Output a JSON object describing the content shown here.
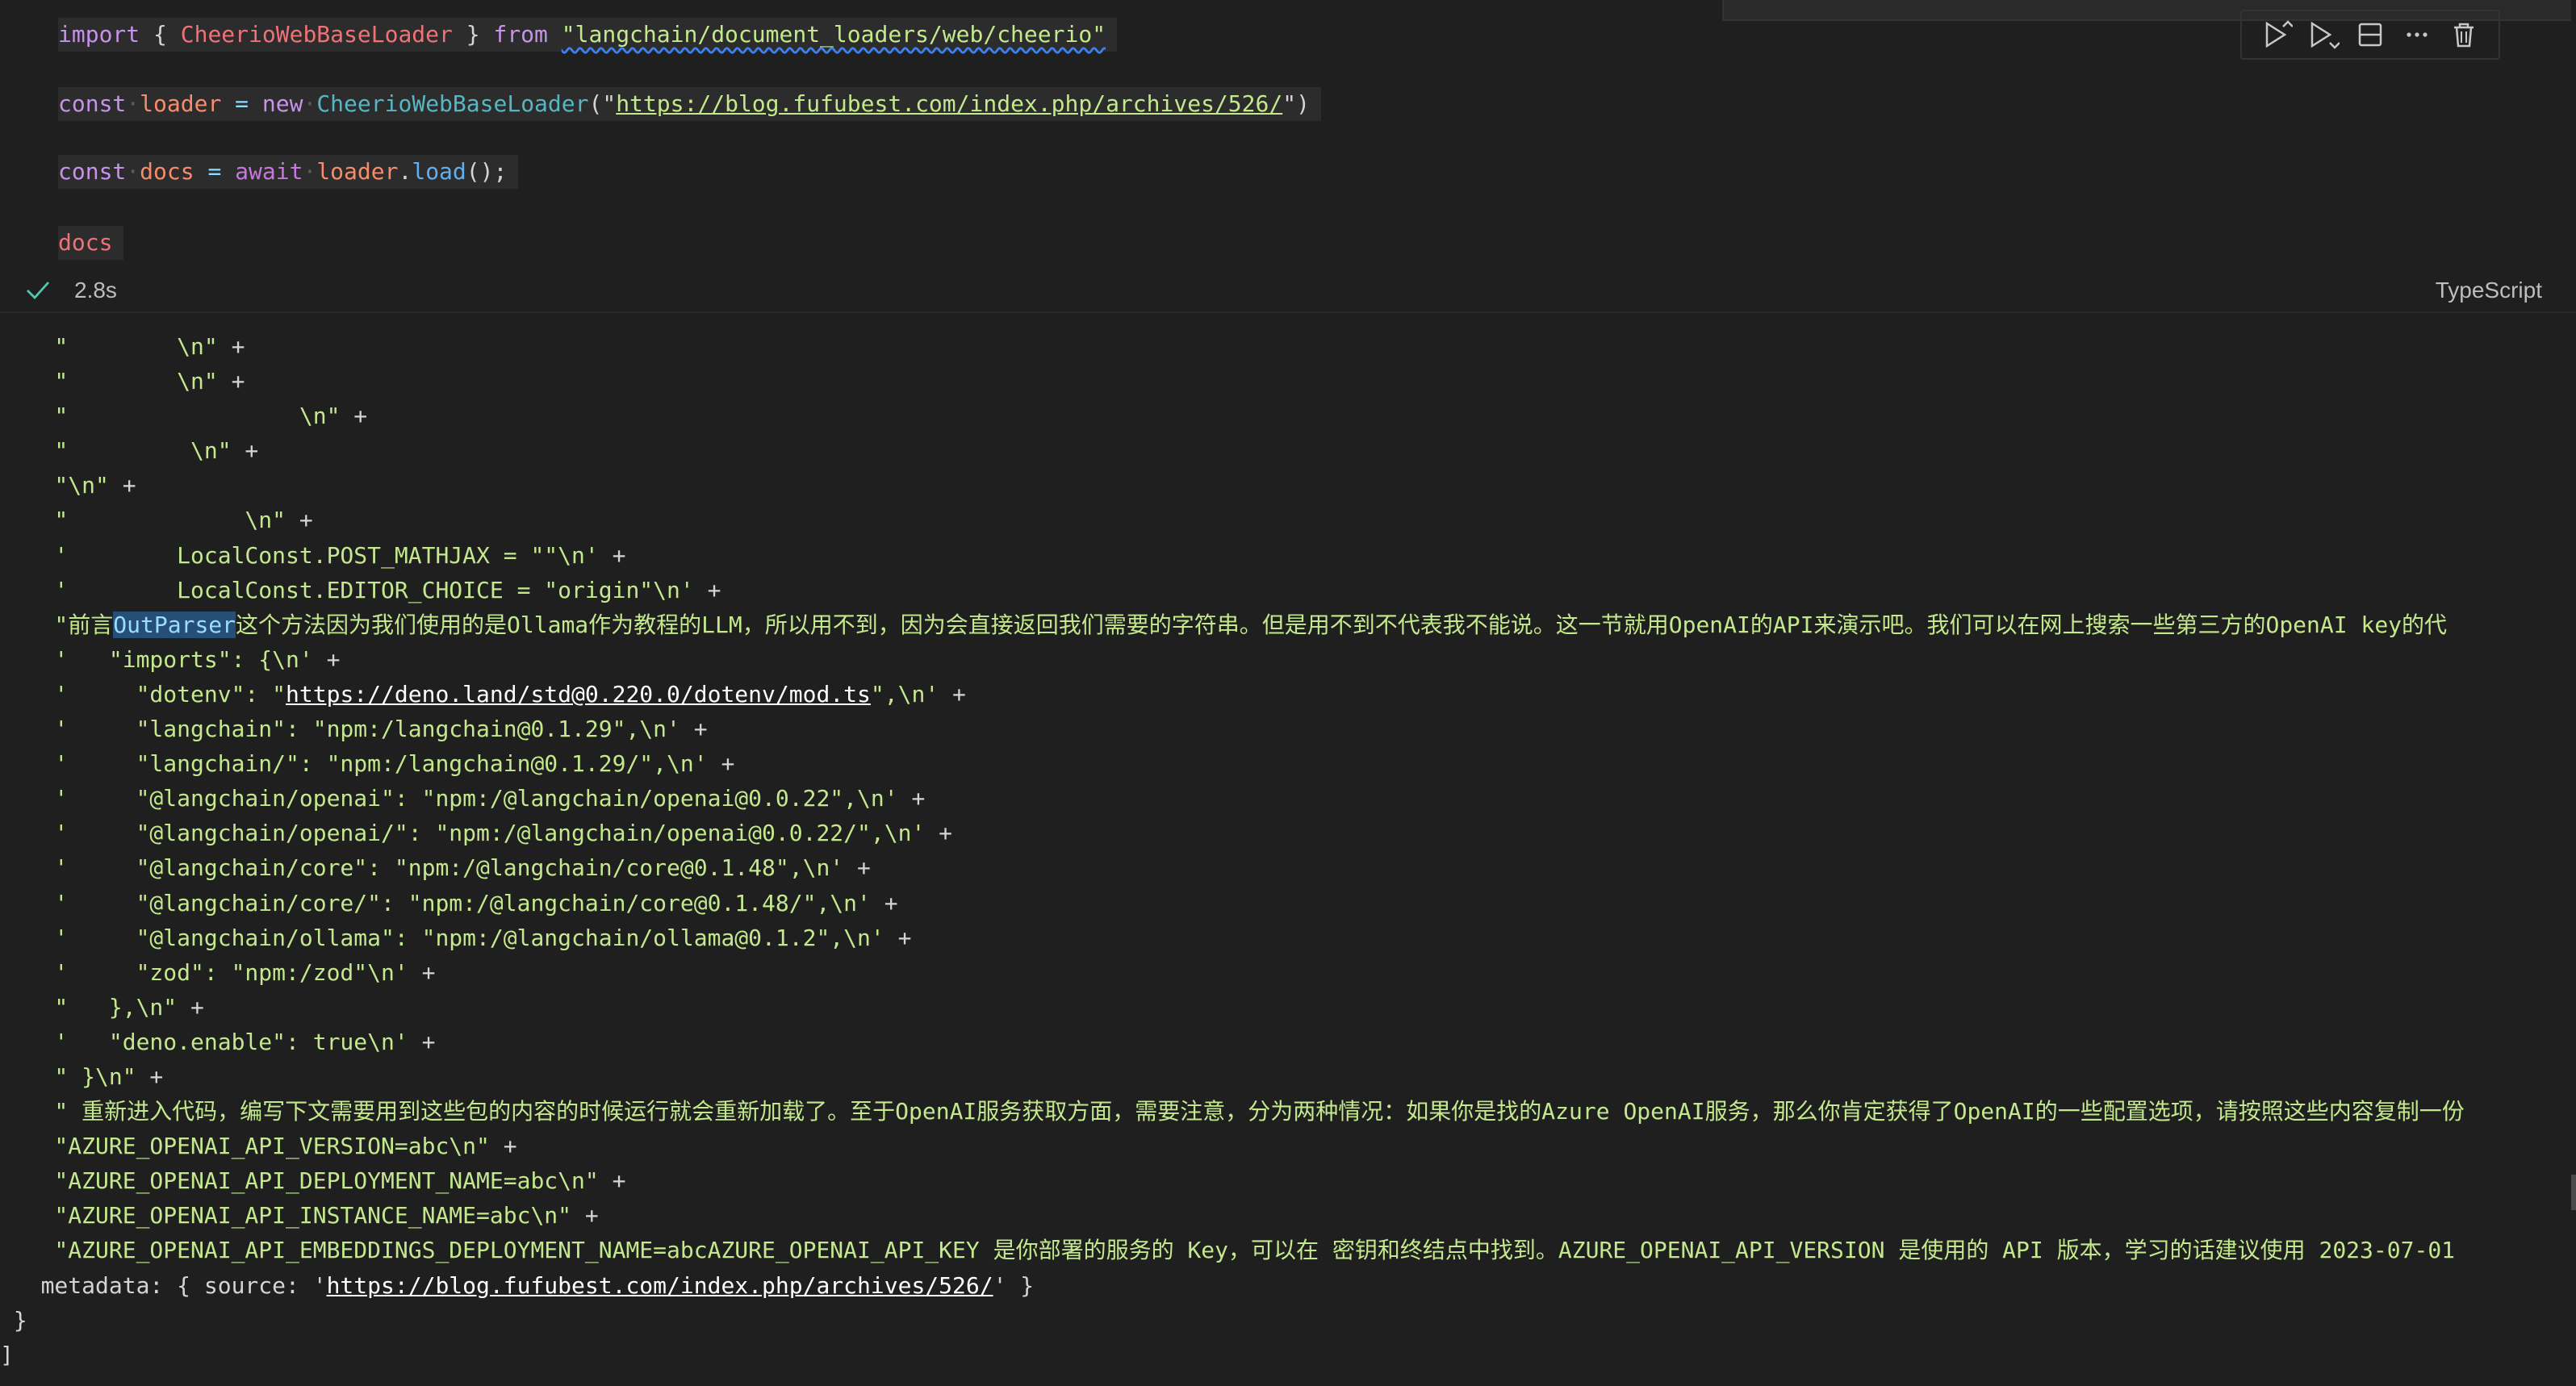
{
  "cell": {
    "code": {
      "line1": {
        "import_kw": "import",
        "brace_open": " { ",
        "class_name": "CheerioWebBaseLoader",
        "brace_close": " } ",
        "from_kw": "from",
        "space": " ",
        "module": "\"langchain/document_loaders/web/cheerio\""
      },
      "line2": {
        "const_kw": "const",
        "var_name": "loader",
        "eq": " = ",
        "new_kw": "new",
        "class_name": "CheerioWebBaseLoader",
        "paren_open": "(\"",
        "url": "https://blog.fufubest.com/index.php/archives/526/",
        "paren_close": "\")"
      },
      "line3": {
        "const_kw": "const",
        "var_name": "docs",
        "eq": " = ",
        "await_kw": "await",
        "obj": "loader",
        "dot": ".",
        "method": "load",
        "tail": "();"
      },
      "line4": {
        "var_name": "docs"
      }
    },
    "toolbar": {
      "icons": [
        "run-above-icon",
        "run-below-icon",
        "split-cell-icon",
        "more-icon",
        "delete-icon"
      ]
    },
    "status": {
      "exec_time": "2.8s",
      "language": "TypeScript"
    }
  },
  "output": {
    "lines": [
      {
        "text": "    \"        \\n\"",
        "plus": " +"
      },
      {
        "text": "    \"        \\n\"",
        "plus": " +"
      },
      {
        "text": "    \"                 \\n\"",
        "plus": " +"
      },
      {
        "text": "    \"         \\n\"",
        "plus": " +"
      },
      {
        "text": "    \"\\n\"",
        "plus": " +"
      },
      {
        "text": "    \"             \\n\"",
        "plus": " +"
      },
      {
        "text": "    '        LocalConst.POST_MATHJAX = \"\"\\n'",
        "plus": " +"
      },
      {
        "text": "    '        LocalConst.EDITOR_CHOICE = \"origin\"\\n'",
        "plus": " +"
      },
      {
        "special": "outparser",
        "pre": "    \"前言",
        "sel": "OutParser",
        "post": "这个方法因为我们使用的是Ollama作为教程的LLM，所以用不到，因为会直接返回我们需要的字符串。但是用不到不代表我不能说。这一节就用OpenAI的API来演示吧。我们可以在网上搜索一些第三方的OpenAI key的代"
      },
      {
        "text": "    '   \"imports\": {\\n'",
        "plus": " +"
      },
      {
        "special": "dotenv",
        "pre": "    '     \"dotenv\": \"",
        "url": "https://deno.land/std@0.220.0/dotenv/mod.ts",
        "post": "\",\\n'",
        "plus": " +"
      },
      {
        "text": "    '     \"langchain\": \"npm:/langchain@0.1.29\",\\n'",
        "plus": " +"
      },
      {
        "text": "    '     \"langchain/\": \"npm:/langchain@0.1.29/\",\\n'",
        "plus": " +"
      },
      {
        "text": "    '     \"@langchain/openai\": \"npm:/@langchain/openai@0.0.22\",\\n'",
        "plus": " +"
      },
      {
        "text": "    '     \"@langchain/openai/\": \"npm:/@langchain/openai@0.0.22/\",\\n'",
        "plus": " +"
      },
      {
        "text": "    '     \"@langchain/core\": \"npm:/@langchain/core@0.1.48\",\\n'",
        "plus": " +"
      },
      {
        "text": "    '     \"@langchain/core/\": \"npm:/@langchain/core@0.1.48/\",\\n'",
        "plus": " +"
      },
      {
        "text": "    '     \"@langchain/ollama\": \"npm:/@langchain/ollama@0.1.2\",\\n'",
        "plus": " +"
      },
      {
        "text": "    '     \"zod\": \"npm:/zod\"\\n'",
        "plus": " +"
      },
      {
        "text": "    \"   },\\n\"",
        "plus": " +"
      },
      {
        "text": "    '   \"deno.enable\": true\\n'",
        "plus": " +"
      },
      {
        "text": "    \" }\\n\"",
        "plus": " +"
      },
      {
        "text": "    \" 重新进入代码，编写下文需要用到这些包的内容的时候运行就会重新加载了。至于OpenAI服务获取方面，需要注意，分为两种情况：如果你是找的Azure OpenAI服务，那么你肯定获得了OpenAI的一些配置选项，请按照这些内容复制一份",
        "plus": ""
      },
      {
        "text": "    \"AZURE_OPENAI_API_VERSION=abc\\n\"",
        "plus": " +"
      },
      {
        "text": "    \"AZURE_OPENAI_API_DEPLOYMENT_NAME=abc\\n\"",
        "plus": " +"
      },
      {
        "text": "    \"AZURE_OPENAI_API_INSTANCE_NAME=abc\\n\"",
        "plus": " +"
      },
      {
        "text": "    \"AZURE_OPENAI_API_EMBEDDINGS_DEPLOYMENT_NAME=abcAZURE_OPENAI_API_KEY 是你部署的服务的 Key，可以在 密钥和终结点中找到。AZURE_OPENAI_API_VERSION 是使用的 API 版本，学习的话建议使用 2023-07-01",
        "plus": ""
      },
      {
        "special": "metadata",
        "pre": "   metadata: { source: '",
        "url": "https://blog.fufubest.com/index.php/archives/526/",
        "post": "' }"
      },
      {
        "meta": true,
        "text": " }"
      },
      {
        "meta": true,
        "text": "]"
      }
    ]
  }
}
